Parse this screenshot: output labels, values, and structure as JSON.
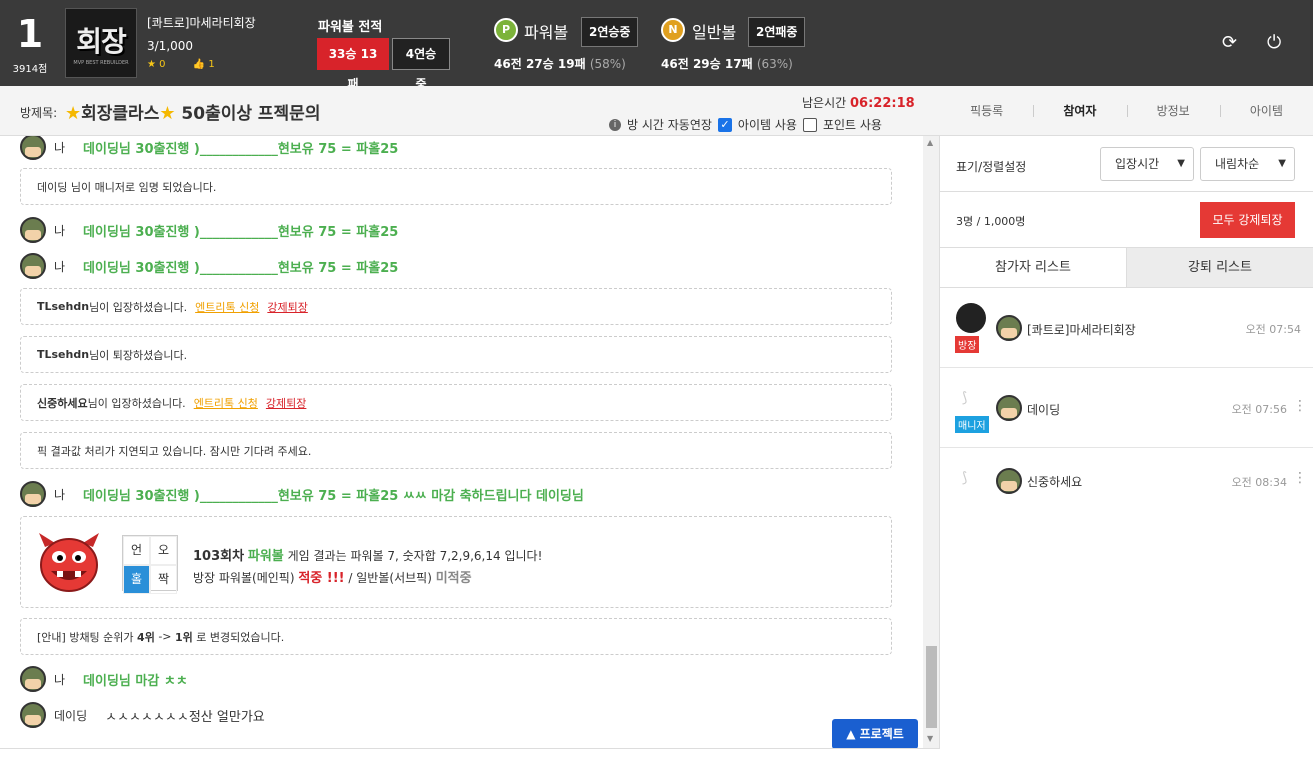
{
  "header": {
    "rank": "1",
    "points": "3914점",
    "logo_text": "회장",
    "logo_sub": "MVP BEST REBUILDER",
    "username": "[콰트로]마세라티회장",
    "count": "3/1,000",
    "stars": "0",
    "likes": "1",
    "powerball_title": "파워볼 전적",
    "powerball_record": "33승 13패",
    "powerball_streak": "4연승중",
    "pball": {
      "icon": "P",
      "label": "파워볼",
      "streak": "2연승중",
      "games": "46전",
      "wins": "27승",
      "losses": "19패",
      "pct": "(58%)"
    },
    "nball": {
      "icon": "N",
      "label": "일반볼",
      "streak": "2연패중",
      "games": "46전",
      "wins": "29승",
      "losses": "17패",
      "pct": "(63%)"
    }
  },
  "room": {
    "title_label": "방제목:",
    "title_text": "회장클라스",
    "title_tail": "50출이상 프젝문의",
    "remaining_label": "남은시간",
    "remaining_time": "06:22:18",
    "auto_extend": "방 시간 자동연장",
    "item_use": "아이템 사용",
    "point_use": "포인트 사용"
  },
  "tabs": [
    "픽등록",
    "참여자",
    "방정보",
    "아이템"
  ],
  "chat": {
    "me": "나",
    "msg1": "데이딩님 30출진행 )____________현보유 75 = 파홀25",
    "sys_manager": "데이딩 님이 매니저로 임명 되었습니다.",
    "msg2": "데이딩님 30출진행 )____________현보유 75 = 파홀25",
    "msg3": "데이딩님 30출진행 )____________현보유 75 = 파홀25",
    "join1_name": "TLsehdn",
    "join_suffix": "님이 입장하셨습니다.",
    "entry_request": "엔트리톡 신청",
    "force_kick": "강제퇴장",
    "leave_name": "TLsehdn",
    "leave_suffix": "님이 퇴장하셨습니다.",
    "join2_name": "신중하세요",
    "delay_notice": "픽 결과값 처리가 지연되고 있습니다. 잠시만 기다려 주세요.",
    "msg4": "데이딩님 30출진행 )____________현보유 75 = 파홀25 ㅆㅆ 마감 축하드립니다 데이딩님",
    "result": {
      "round": "103회차",
      "game": "파워볼",
      "desc": "게임 결과는 파워볼 7, 숫자합 7,2,9,6,14 입니다!",
      "owner_pb": "방장 파워볼(메인픽)",
      "hit": "적중 !!!",
      "sep": "/",
      "owner_nb": "일반볼(서브픽)",
      "miss": "미적중",
      "grid": [
        "언",
        "오",
        "홀",
        "짝"
      ]
    },
    "rank_notice_pre": "[안내] 방채팅 순위가",
    "rank_from": "4위",
    "rank_arrow": "->",
    "rank_to": "1위",
    "rank_notice_post": "로 변경되었습니다.",
    "msg5": "데이딩님 마감 ㅊㅊ",
    "other_name": "데이딩",
    "msg6": "ㅅㅅㅅㅅㅅㅅㅅ정산 얼만가요",
    "project_btn": "▲ 프로젝트"
  },
  "panel": {
    "sort_label": "표기/정렬설정",
    "sort_by": "입장시간",
    "sort_order": "내림차순",
    "count": "3명 / 1,000명",
    "kick_all": "모두 강제퇴장",
    "tab_participants": "참가자 리스트",
    "tab_kicked": "강퇴 리스트",
    "participants": [
      {
        "name": "[콰트로]마세라티회장",
        "time": "오전 07:54",
        "tag": "방장"
      },
      {
        "name": "데이딩",
        "time": "오전 07:56",
        "tag": "매니저"
      },
      {
        "name": "신중하세요",
        "time": "오전 08:34",
        "tag": ""
      }
    ]
  },
  "colors": {
    "accent_red": "#d8232a",
    "accent_green": "#4caf50",
    "accent_blue": "#1a5fd0"
  }
}
